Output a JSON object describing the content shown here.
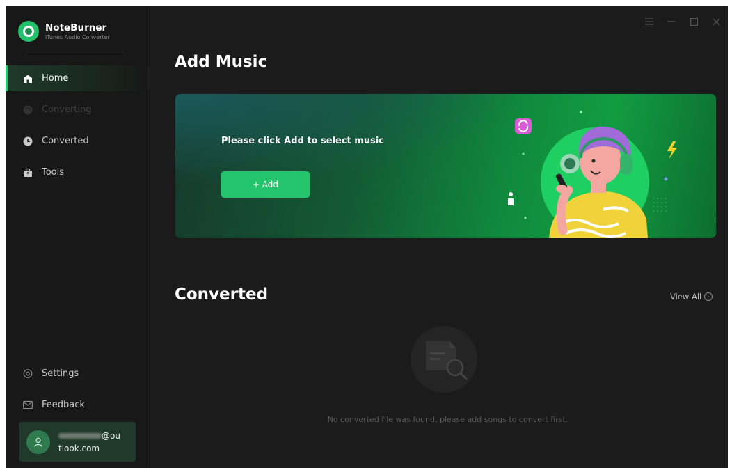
{
  "app": {
    "name": "NoteBurner",
    "subtitle": "iTunes Audio Converter"
  },
  "sidebar": {
    "items": [
      {
        "label": "Home",
        "icon": "home-icon",
        "active": true
      },
      {
        "label": "Converting",
        "icon": "converting-icon",
        "disabled": true
      },
      {
        "label": "Converted",
        "icon": "clock-icon"
      },
      {
        "label": "Tools",
        "icon": "toolbox-icon"
      }
    ],
    "bottom_items": [
      {
        "label": "Settings",
        "icon": "gear-icon"
      },
      {
        "label": "Feedback",
        "icon": "mail-icon"
      }
    ],
    "user": {
      "email_line1": "@ou",
      "email_line2": "tlook.com"
    }
  },
  "titlebar": {
    "buttons": [
      "menu-icon",
      "minimize-icon",
      "maximize-icon",
      "close-icon"
    ]
  },
  "main": {
    "add_music_title": "Add Music",
    "banner": {
      "prompt": "Please click Add to select music",
      "add_button_label": "+ Add"
    },
    "converted_title": "Converted",
    "view_all_label": "View All",
    "empty_message": "No converted file was found, please add songs to convert first."
  },
  "colors": {
    "accent": "#24c46d",
    "background": "#1b1b1b",
    "sidebar": "#181818"
  }
}
